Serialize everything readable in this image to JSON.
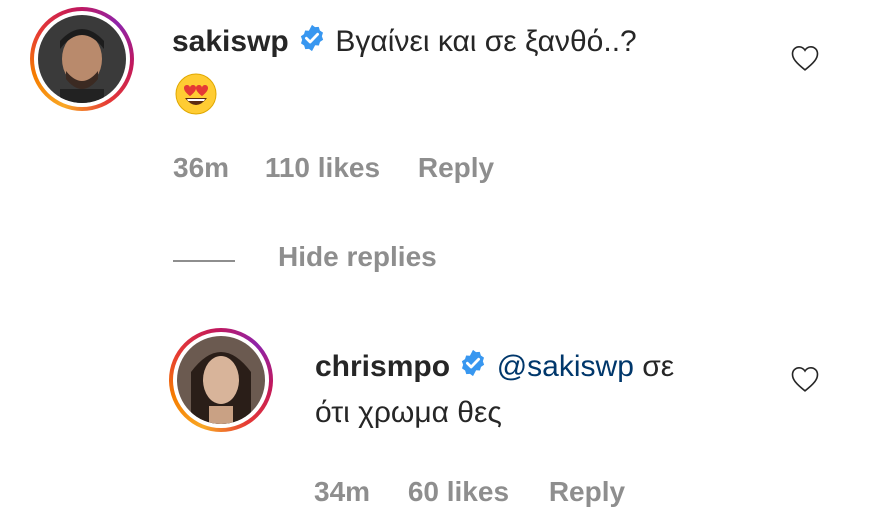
{
  "comment": {
    "username": "sakiswp",
    "text": "Βγαίνει και σε ξανθό..?",
    "emoji": "😍",
    "emoji_name": "heart-eyes-emoji",
    "time": "36m",
    "likes": "110 likes",
    "reply_label": "Reply"
  },
  "toggle": {
    "label": "Hide replies"
  },
  "reply": {
    "username": "chrismpo",
    "mention": "@sakiswp",
    "text_line1": " σε",
    "text_line2": "ότι χρωμα θες",
    "time": "34m",
    "likes": "60 likes",
    "reply_label": "Reply"
  },
  "colors": {
    "verified": "#3897f0",
    "meta_text": "#8e8e8e",
    "mention": "#00376b"
  }
}
